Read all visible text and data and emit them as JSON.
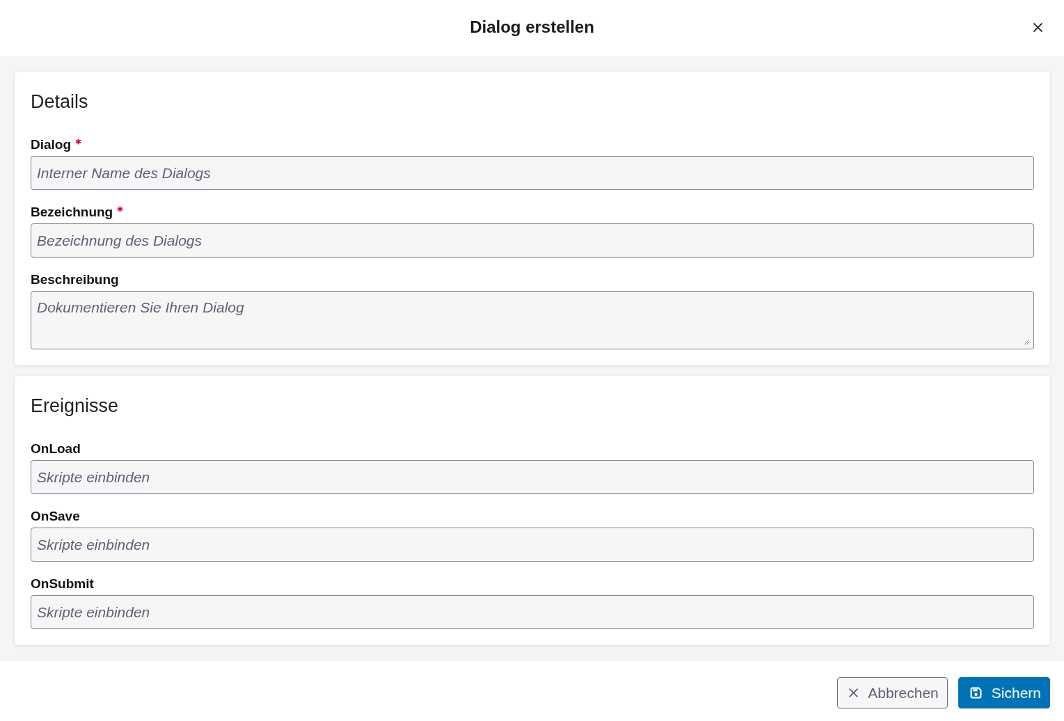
{
  "dialog": {
    "title": "Dialog erstellen"
  },
  "sections": [
    {
      "title": "Details",
      "fields": [
        {
          "label": "Dialog",
          "required": true,
          "kind": "input",
          "placeholder": "Interner Name des Dialogs"
        },
        {
          "label": "Bezeichnung",
          "required": true,
          "kind": "input",
          "placeholder": "Bezeichnung des Dialogs"
        },
        {
          "label": "Beschreibung",
          "required": false,
          "kind": "textarea",
          "placeholder": "Dokumentieren Sie Ihren Dialog"
        }
      ]
    },
    {
      "title": "Ereignisse",
      "fields": [
        {
          "label": "OnLoad",
          "required": false,
          "kind": "input",
          "placeholder": "Skripte einbinden"
        },
        {
          "label": "OnSave",
          "required": false,
          "kind": "input",
          "placeholder": "Skripte einbinden"
        },
        {
          "label": "OnSubmit",
          "required": false,
          "kind": "input",
          "placeholder": "Skripte einbinden"
        }
      ]
    }
  ],
  "buttons": [
    {
      "label": "Abbrechen",
      "kind": "secondary"
    },
    {
      "label": "Sichern",
      "kind": "primary"
    }
  ]
}
